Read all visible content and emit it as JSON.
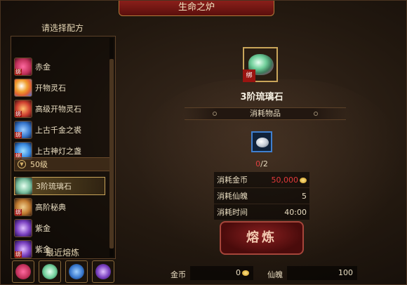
{
  "window": {
    "title": "生命之炉"
  },
  "left_panel": {
    "title": "请选择配方",
    "bound_tag": "绑",
    "recipes_top": [
      {
        "label": "赤金",
        "color": "#c0305a"
      },
      {
        "label": "开物灵石",
        "color": "#e06030"
      },
      {
        "label": "高级开物灵石",
        "color": "#d04030"
      },
      {
        "label": "上古千金之裘",
        "color": "#3a7ad0"
      },
      {
        "label": "上古神灯之盏",
        "color": "#3a8ae0"
      }
    ],
    "level_header": "50级",
    "recipes_bottom": [
      {
        "label": "3阶琉璃石",
        "color": "#7ac0a0",
        "selected": true
      },
      {
        "label": "高阶秘典",
        "color": "#c07a30"
      },
      {
        "label": "紫金",
        "color": "#7a40c0"
      },
      {
        "label": "紫金",
        "color": "#7a40c0"
      }
    ],
    "recent_title": "最近熔炼",
    "recent_colors": [
      "#c0305a",
      "#6fcf9a",
      "#3a7ad0",
      "#7a40c0"
    ]
  },
  "main": {
    "item_name": "3阶琉璃石",
    "item_bound": "绑",
    "consume_title": "消耗物品",
    "material_count_have": "0",
    "material_count_need": "/2",
    "costs": [
      {
        "label": "消耗金币",
        "value": "50,000",
        "highlight": true,
        "coin": true
      },
      {
        "label": "消耗仙魄",
        "value": "5"
      },
      {
        "label": "消耗时间",
        "value": "40:00"
      }
    ],
    "smelt_button": "熔炼"
  },
  "bottom": {
    "gold_label": "金币",
    "gold_value": "0",
    "soul_label": "仙魄",
    "soul_value": "100"
  }
}
